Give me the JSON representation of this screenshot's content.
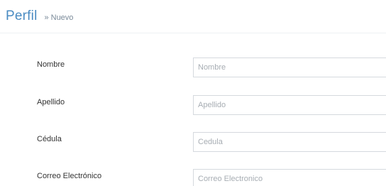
{
  "header": {
    "title": "Perfil",
    "separator": "»",
    "subtitle": "Nuevo"
  },
  "form": {
    "fields": [
      {
        "label": "Nombre",
        "placeholder": "Nombre",
        "value": ""
      },
      {
        "label": "Apellido",
        "placeholder": "Apellido",
        "value": ""
      },
      {
        "label": "Cédula",
        "placeholder": "Cedula",
        "value": ""
      },
      {
        "label": "Correo Electrónico",
        "placeholder": "Correo Electronico",
        "value": ""
      }
    ]
  }
}
